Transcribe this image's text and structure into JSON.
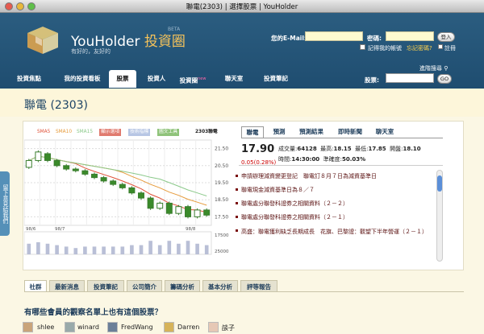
{
  "window": {
    "title": "聯電(2303) | 選擇股票 | YouHolder"
  },
  "header": {
    "logo_name": "YouHolder",
    "logo_suffix": "投資圈",
    "logo_beta": "BETA",
    "tagline": "有好的，友好的",
    "email_label": "您的E-Mail:",
    "password_label": "密碼:",
    "login_button": "登入",
    "remember_label": "記得我的帳號",
    "forgot_link": "忘記密碼?",
    "register_link": "註冊",
    "advanced_search": "進階搜尋",
    "stock_label": "股票:",
    "go_button": "GO"
  },
  "nav": {
    "tabs": [
      "投資焦點",
      "我的投資看板",
      "股票",
      "投資人",
      "投資圈",
      "聯天室",
      "投資筆記"
    ],
    "active_tab": "股票",
    "new_badge": "new"
  },
  "page": {
    "title": "聯電 (2303)"
  },
  "sidebar": {
    "feedback_tab": "留下意見給我們"
  },
  "chart_data": {
    "type": "line",
    "legend": [
      "SMA5",
      "SMA10",
      "SMA15",
      "顯示選項",
      "技術指標",
      "圖文工具",
      "2303聯電"
    ],
    "y_ticks": [
      "21.50",
      "20.50",
      "19.50",
      "18.50",
      "17.50"
    ],
    "vol_ticks": [
      "17500",
      "25000"
    ],
    "x_ticks": [
      "98/6",
      "98/7",
      "98/8"
    ],
    "ylim": [
      17.0,
      22.0
    ],
    "candles": [
      {
        "o": 20.4,
        "c": 20.8
      },
      {
        "o": 20.8,
        "c": 21.3
      },
      {
        "o": 21.2,
        "c": 20.8
      },
      {
        "o": 20.8,
        "c": 20.5
      },
      {
        "o": 20.5,
        "c": 20.3
      },
      {
        "o": 20.3,
        "c": 20.2
      },
      {
        "o": 20.2,
        "c": 20.0
      },
      {
        "o": 20.0,
        "c": 19.8
      },
      {
        "o": 19.8,
        "c": 19.6
      },
      {
        "o": 19.6,
        "c": 19.4
      },
      {
        "o": 19.4,
        "c": 19.2
      },
      {
        "o": 19.2,
        "c": 18.9
      },
      {
        "o": 18.9,
        "c": 18.6
      },
      {
        "o": 18.6,
        "c": 18.0
      },
      {
        "o": 18.0,
        "c": 18.3
      },
      {
        "o": 18.3,
        "c": 17.7
      },
      {
        "o": 17.7,
        "c": 18.1
      },
      {
        "o": 18.1,
        "c": 17.5
      },
      {
        "o": 17.5,
        "c": 17.9
      },
      {
        "o": 17.9,
        "c": 17.6
      }
    ]
  },
  "quote": {
    "tabs": [
      "聯電",
      "預測",
      "預測結果",
      "即時新聞",
      "聊天室"
    ],
    "active_tab": "聯電",
    "price": "17.90",
    "change": "0.05(0.28%)",
    "volume_label": "成交量:",
    "volume": "64128",
    "high_label": "最高:",
    "high": "18.15",
    "low_label": "最低:",
    "low": "17.85",
    "open_label": "開盤:",
    "open": "18.10",
    "time_label": "時間:",
    "time": "14:30:00",
    "accuracy_label": "準確度:",
    "accuracy": "50.03%"
  },
  "news": [
    "申請辦理減資變更登記　聯電訂８月７日為減資基準日",
    "聯電現金減資基準日為８／７",
    "聯電處分聯發科證券之相關資料（２－２）",
    "聯電處分聯發科證券之相關資料（２－１）",
    "高盛：聯電獲利缺乏長期成長　花旗、巴黎證：觀望下半年營運（２－１）"
  ],
  "bottom": {
    "tabs": [
      "社群",
      "最新消息",
      "投資筆記",
      "公司簡介",
      "籌碼分析",
      "基本分析",
      "評等報告"
    ],
    "active_tab": "社群",
    "heading": "有哪些會員的觀察名單上也有這個股票？",
    "users": [
      "shlee",
      "winard",
      "FredWang",
      "Darren",
      "燄子"
    ]
  }
}
